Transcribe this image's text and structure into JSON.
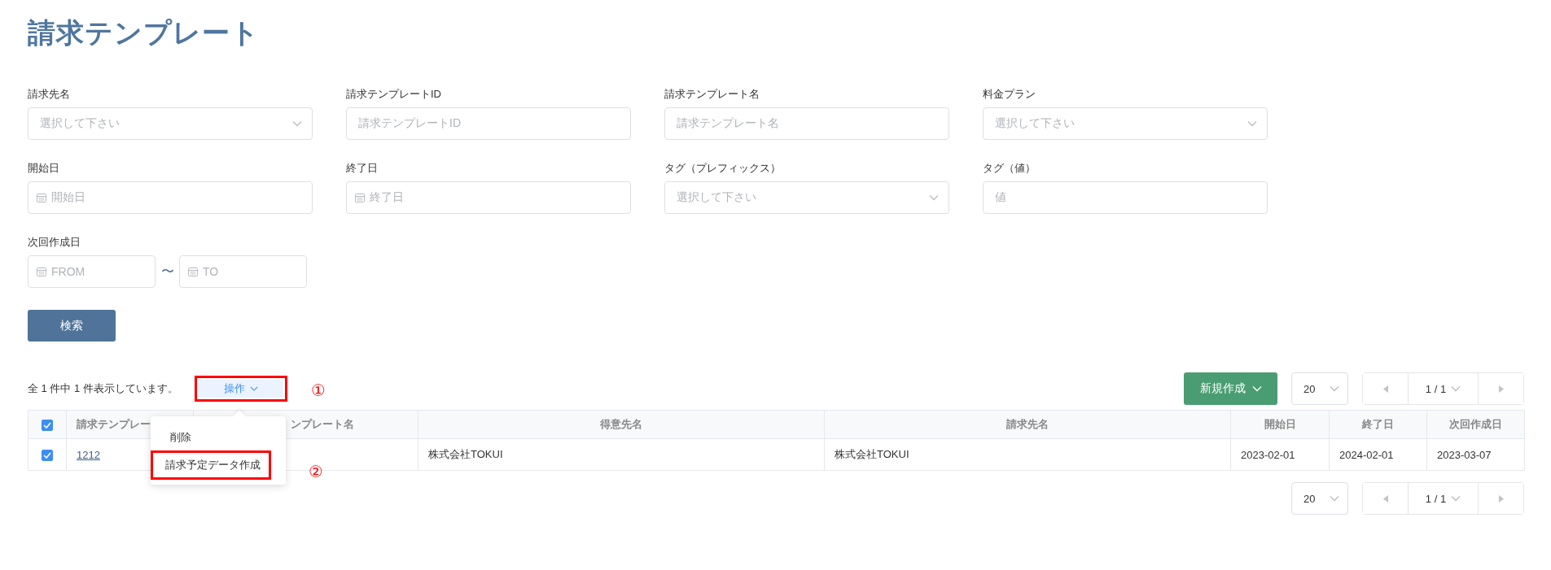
{
  "title": "請求テンプレート",
  "filters": [
    {
      "label": "請求先名",
      "kind": "select",
      "placeholder": "選択して下さい"
    },
    {
      "label": "請求テンプレートID",
      "kind": "text",
      "placeholder": "請求テンプレートID"
    },
    {
      "label": "請求テンプレート名",
      "kind": "text",
      "placeholder": "請求テンプレート名"
    },
    {
      "label": "料金プラン",
      "kind": "select",
      "placeholder": "選択して下さい"
    },
    {
      "label": "開始日",
      "kind": "date",
      "placeholder": "開始日"
    },
    {
      "label": "終了日",
      "kind": "date",
      "placeholder": "終了日"
    },
    {
      "label": "タグ（プレフィックス）",
      "kind": "select",
      "placeholder": "選択して下さい"
    },
    {
      "label": "タグ（値）",
      "kind": "text",
      "placeholder": "値"
    }
  ],
  "date_range": {
    "label": "次回作成日",
    "from": {
      "placeholder": "FROM"
    },
    "separator": "〜",
    "to": {
      "placeholder": "TO"
    }
  },
  "search_button": "検索",
  "result_count": "全 1 件中 1 件表示しています。",
  "actions_button": {
    "label": "操作",
    "highlighted": true,
    "annotation": "①"
  },
  "actions_menu": {
    "items": [
      {
        "label": "削除",
        "highlighted": false
      },
      {
        "label": "請求予定データ作成",
        "highlighted": true,
        "annotation": "②"
      }
    ]
  },
  "new_button": "新規作成",
  "pagination_top": {
    "page_size": "20",
    "page": "1 / 1"
  },
  "table": {
    "header_checked": true,
    "columns": [
      "請求テンプレー",
      "ンプレート名",
      "得意先名",
      "請求先名",
      "開始日",
      "終了日",
      "次回作成日"
    ],
    "rows": [
      {
        "checked": true,
        "id": "1212",
        "customer": "株式会社TOKUI",
        "billing_to": "株式会社TOKUI",
        "start": "2023-02-01",
        "end": "2024-02-01",
        "next": "2023-03-07"
      }
    ]
  },
  "pagination_bottom": {
    "page_size": "20",
    "page": "1 / 1"
  }
}
